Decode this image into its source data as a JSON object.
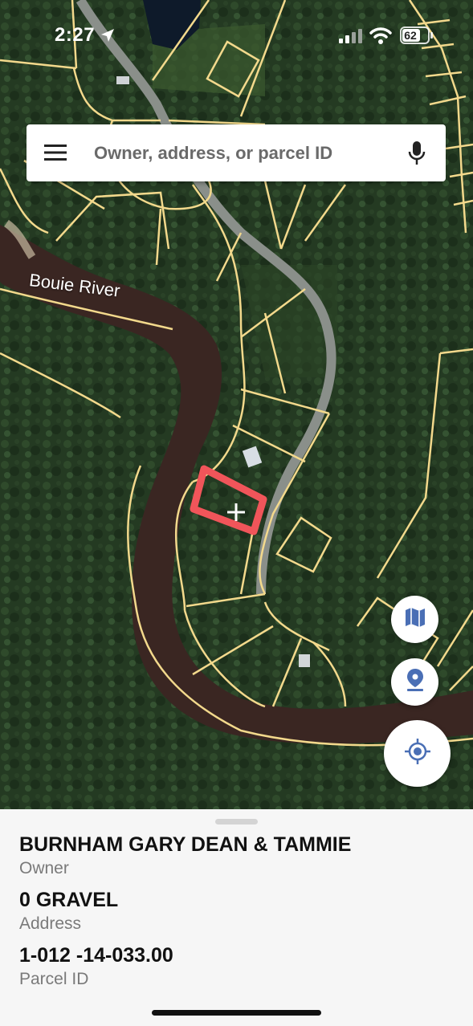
{
  "status_bar": {
    "time": "2:27",
    "battery_level": "62"
  },
  "search": {
    "placeholder": "Owner, address, or parcel ID"
  },
  "map": {
    "river_label": "Bouie River",
    "parcel_outline_color": "#f0555a",
    "lot_line_color": "#f3d98c"
  },
  "parcel": {
    "owner": "BURNHAM GARY DEAN & TAMMIE",
    "owner_label": "Owner",
    "address": "0 GRAVEL",
    "address_label": "Address",
    "parcel_id": "1-012 -14-033.00",
    "parcel_id_label": "Parcel ID"
  },
  "icons": [
    "menu-icon",
    "microphone-icon",
    "map-layers-icon",
    "location-pin-icon",
    "my-location-icon",
    "location-arrow-icon",
    "signal-icon",
    "wifi-icon",
    "battery-icon"
  ]
}
